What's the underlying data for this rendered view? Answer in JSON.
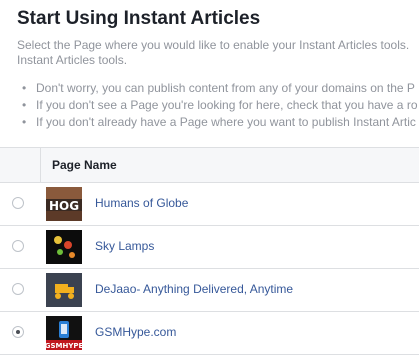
{
  "header": {
    "title": "Start Using Instant Articles",
    "description": "Select the Page where you would like to enable your Instant Articles tools. Instant Articles tools."
  },
  "tips": [
    "Don't worry, you can publish content from any of your domains on the P",
    "If you don't see a Page you're looking for here, check that you have a ro",
    "If you don't already have a Page where you want to publish Instant Artic"
  ],
  "table": {
    "column_header": "Page Name",
    "rows": [
      {
        "name": "Humans of Globe",
        "selected": false,
        "thumb_label": "HOG",
        "thumb_icon": "humans-of-globe-logo"
      },
      {
        "name": "Sky Lamps",
        "selected": false,
        "thumb_icon": "sky-lamps-logo"
      },
      {
        "name": "DeJaao- Anything Delivered, Anytime",
        "selected": false,
        "thumb_icon": "dejaao-delivery-scooter-logo"
      },
      {
        "name": "GSMHype.com",
        "selected": true,
        "thumb_label": "GSMHYPE",
        "thumb_icon": "gsmhype-phone-logo"
      }
    ]
  },
  "colors": {
    "link": "#365899",
    "muted_text": "#90949c",
    "border": "#dddfe2",
    "header_bg": "#f6f7f9"
  }
}
